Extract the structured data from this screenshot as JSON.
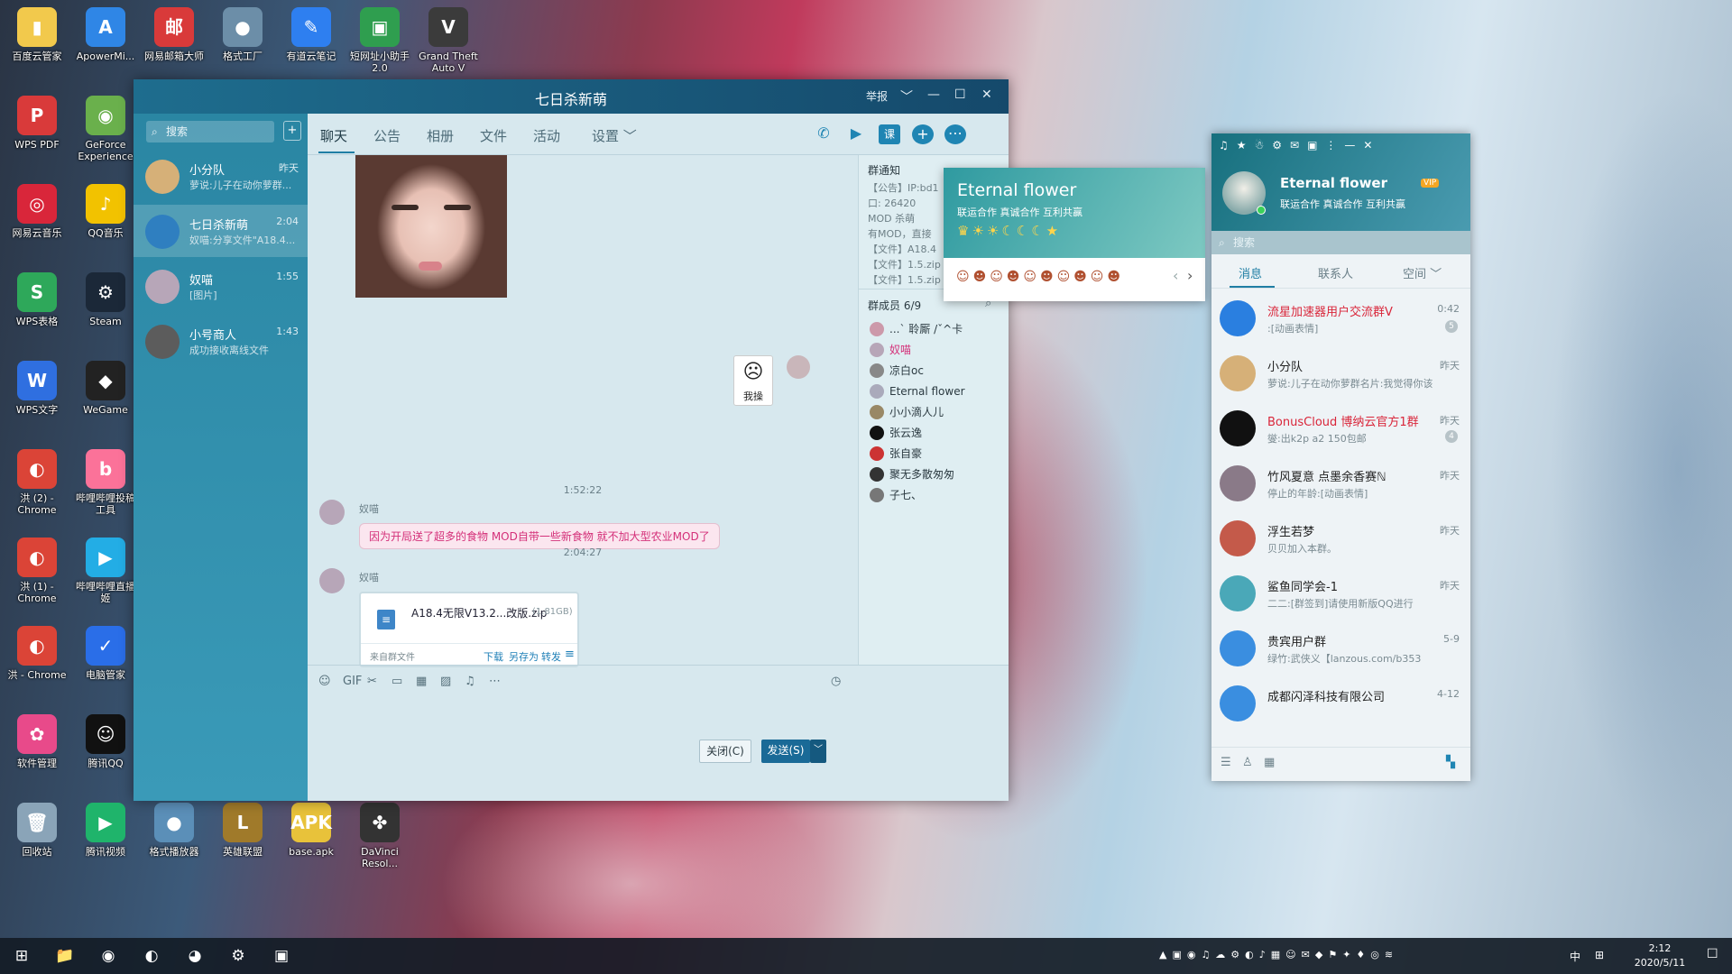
{
  "desktop": {
    "icons": [
      {
        "label": "百度云管家",
        "glyph": "▮",
        "color": "#f2c94c"
      },
      {
        "label": "ApowerMi...",
        "glyph": "A",
        "color": "#2f86e6"
      },
      {
        "label": "网易邮箱大师",
        "glyph": "邮",
        "color": "#d93a3a"
      },
      {
        "label": "格式工厂",
        "glyph": "●",
        "color": "#6c8ea8"
      },
      {
        "label": "有道云笔记",
        "glyph": "✎",
        "color": "#2e7ff0"
      },
      {
        "label": "短网址小助手2.0",
        "glyph": "▣",
        "color": "#2f9e4f"
      },
      {
        "label": "Grand Theft Auto V",
        "glyph": "V",
        "color": "#3b3b3b"
      },
      {
        "label": "WPS PDF",
        "glyph": "P",
        "color": "#d93a3a"
      },
      {
        "label": "GeForce Experience",
        "glyph": "◉",
        "color": "#6ab04c"
      },
      {
        "label": "网易云音乐",
        "glyph": "◎",
        "color": "#d9263a"
      },
      {
        "label": "QQ音乐",
        "glyph": "♪",
        "color": "#f2c200"
      },
      {
        "label": "WPS表格",
        "glyph": "S",
        "color": "#2ea85a"
      },
      {
        "label": "Steam",
        "glyph": "⚙",
        "color": "#1b2838"
      },
      {
        "label": "WPS文字",
        "glyph": "W",
        "color": "#2f6fe0"
      },
      {
        "label": "WeGame",
        "glyph": "◆",
        "color": "#222"
      },
      {
        "label": "洪 (2) - Chrome",
        "glyph": "◐",
        "color": "#db4437"
      },
      {
        "label": "哔哩哔哩投稿工具",
        "glyph": "b",
        "color": "#fb7299"
      },
      {
        "label": "洪 (1) - Chrome",
        "glyph": "◐",
        "color": "#db4437"
      },
      {
        "label": "哔哩哔哩直播姬",
        "glyph": "▶",
        "color": "#23ade5"
      },
      {
        "label": "洪 - Chrome",
        "glyph": "◐",
        "color": "#db4437"
      },
      {
        "label": "电脑管家",
        "glyph": "✓",
        "color": "#2a6ee8"
      },
      {
        "label": "软件管理",
        "glyph": "✿",
        "color": "#e84a8a"
      },
      {
        "label": "腾讯QQ",
        "glyph": "☺",
        "color": "#111"
      },
      {
        "label": "回收站",
        "glyph": "🗑",
        "color": "#8aa4b8"
      },
      {
        "label": "腾讯视频",
        "glyph": "▶",
        "color": "#1fb46b"
      },
      {
        "label": "格式播放器",
        "glyph": "●",
        "color": "#5b8fb8"
      },
      {
        "label": "英雄联盟",
        "glyph": "L",
        "color": "#a07a2a"
      },
      {
        "label": "base.apk",
        "glyph": "APK",
        "color": "#e8c23a"
      },
      {
        "label": "DaVinci Resol...",
        "glyph": "✤",
        "color": "#333"
      }
    ]
  },
  "chat": {
    "title": "七日杀新萌",
    "title_controls": [
      "举报",
      "﹀",
      "—",
      "☐",
      "✕"
    ],
    "search_placeholder": "搜索",
    "plus": "+",
    "conversations": [
      {
        "name": "小分队",
        "time": "昨天",
        "preview": "萝说:儿子在动你萝群...",
        "color": "#d6b078"
      },
      {
        "name": "七日杀新萌",
        "time": "2:04",
        "preview": "奴喵:分享文件\"A18.4...",
        "color": "#2f7fc0"
      },
      {
        "name": "奴喵",
        "time": "1:55",
        "preview": "[图片]",
        "color": "#b7a6b8"
      },
      {
        "name": "小号商人",
        "time": "1:43",
        "preview": "成功接收离线文件",
        "color": "#5c5c5c"
      }
    ],
    "tabs": [
      "聊天",
      "公告",
      "相册",
      "文件",
      "活动",
      "设置 ﹀"
    ],
    "top_icons": [
      "phone-icon",
      "video-icon",
      "class-icon",
      "add-icon",
      "more-icon"
    ],
    "timestamp1": "1:52:22",
    "sender1": "奴喵",
    "message1": "因为开局送了超多的食物 MOD自带一些新食物 就不加大型农业MOD了",
    "timestamp2": "2:04:27",
    "sender2": "奴喵",
    "sticker_text": "我操",
    "file": {
      "name": "A18.4无限V13.2...改版.zip",
      "size": "(1.81GB)",
      "source": "来自群文件",
      "download": "下载",
      "save_as": "另存为",
      "forward": "转发",
      "menu": "≡"
    },
    "notice": {
      "title": "群通知",
      "lines": [
        "【公告】IP:bd1",
        "口: 26420",
        "MOD 杀萌",
        "有MOD，直接",
        "【文件】A18.4",
        "【文件】1.5.zip",
        "【文件】1.5.zip"
      ]
    },
    "members_title": "群成员 6/9",
    "members": [
      {
        "name": "...` 聆厮 /ˇ^卡",
        "color": "#c9a"
      },
      {
        "name": "奴喵",
        "color": "#b7a6b8",
        "red": true
      },
      {
        "name": "凉白oc",
        "color": "#888"
      },
      {
        "name": "Eternal flower",
        "color": "#aab"
      },
      {
        "name": "小小滴人儿",
        "color": "#986"
      },
      {
        "name": "张云逸",
        "color": "#111"
      },
      {
        "name": "张自豪",
        "color": "#c33"
      },
      {
        "name": "聚无多散匆匆",
        "color": "#333"
      },
      {
        "name": "子七、",
        "color": "#777"
      }
    ],
    "input_tools": [
      "☺",
      "GIF",
      "✂",
      "▭",
      "▦",
      "▨",
      "♫",
      "⋯"
    ],
    "history_icon": "◷",
    "close_btn": "关闭(C)",
    "send_btn": "发送(S)",
    "send_arrow": "﹀"
  },
  "popup": {
    "name": "Eternal flower",
    "signature": "联运合作 真诚合作 互利共赢",
    "badges": "♛☀☀☾☾☾★",
    "emojis": "☺☻☺☻☺☻☺☻☺☻",
    "prev": "‹",
    "next": "›"
  },
  "qq": {
    "name": "Eternal flower",
    "vip": "VIP",
    "signature": "联运合作 真诚合作 互利共赢",
    "search_placeholder": "搜索",
    "tabs": [
      "消息",
      "联系人",
      "空间 ﹀"
    ],
    "rows": [
      {
        "name": "流星加速器用户交流群V",
        "time": "0:42",
        "preview": ":[动画表情]",
        "badge": "5",
        "red": true,
        "color": "#2a7fe0"
      },
      {
        "name": "小分队",
        "time": "昨天",
        "preview": "萝说:儿子在动你萝群名片:我觉得你该",
        "badge": "",
        "red": false,
        "color": "#d6b078"
      },
      {
        "name": "BonusCloud 博纳云官方1群",
        "time": "昨天",
        "preview": "燮:出k2p a2  150包邮",
        "badge": "4",
        "red": true,
        "color": "#111"
      },
      {
        "name": "竹风夏意 点墨余香赛ℕ",
        "time": "昨天",
        "preview": "停止的年龄:[动画表情]",
        "badge": "",
        "red": false,
        "color": "#8a7a88"
      },
      {
        "name": "浮生若梦",
        "time": "昨天",
        "preview": "贝贝加入本群。",
        "badge": "",
        "red": false,
        "color": "#c45a4a"
      },
      {
        "name": "鲨鱼同学会-1",
        "time": "昨天",
        "preview": "二二:[群签到]请使用新版QQ进行",
        "badge": "",
        "red": false,
        "color": "#4aa8b8"
      },
      {
        "name": "贵宾用户群",
        "time": "5-9",
        "preview": "绿竹:武侠义【lanzous.com/b353",
        "badge": "",
        "red": false,
        "color": "#3a8ee0"
      },
      {
        "name": "成都闪泽科技有限公司",
        "time": "4-12",
        "preview": "",
        "badge": "",
        "red": false,
        "color": "#3a8ee0"
      }
    ]
  },
  "taskbar": {
    "apps": [
      "⊞",
      "📁",
      "◉",
      "◐",
      "◕",
      "⚙",
      "▣"
    ],
    "time": "2:12",
    "date": "2020/5/11",
    "ime": "中",
    "grid": "⊞",
    "notify": "☐"
  }
}
